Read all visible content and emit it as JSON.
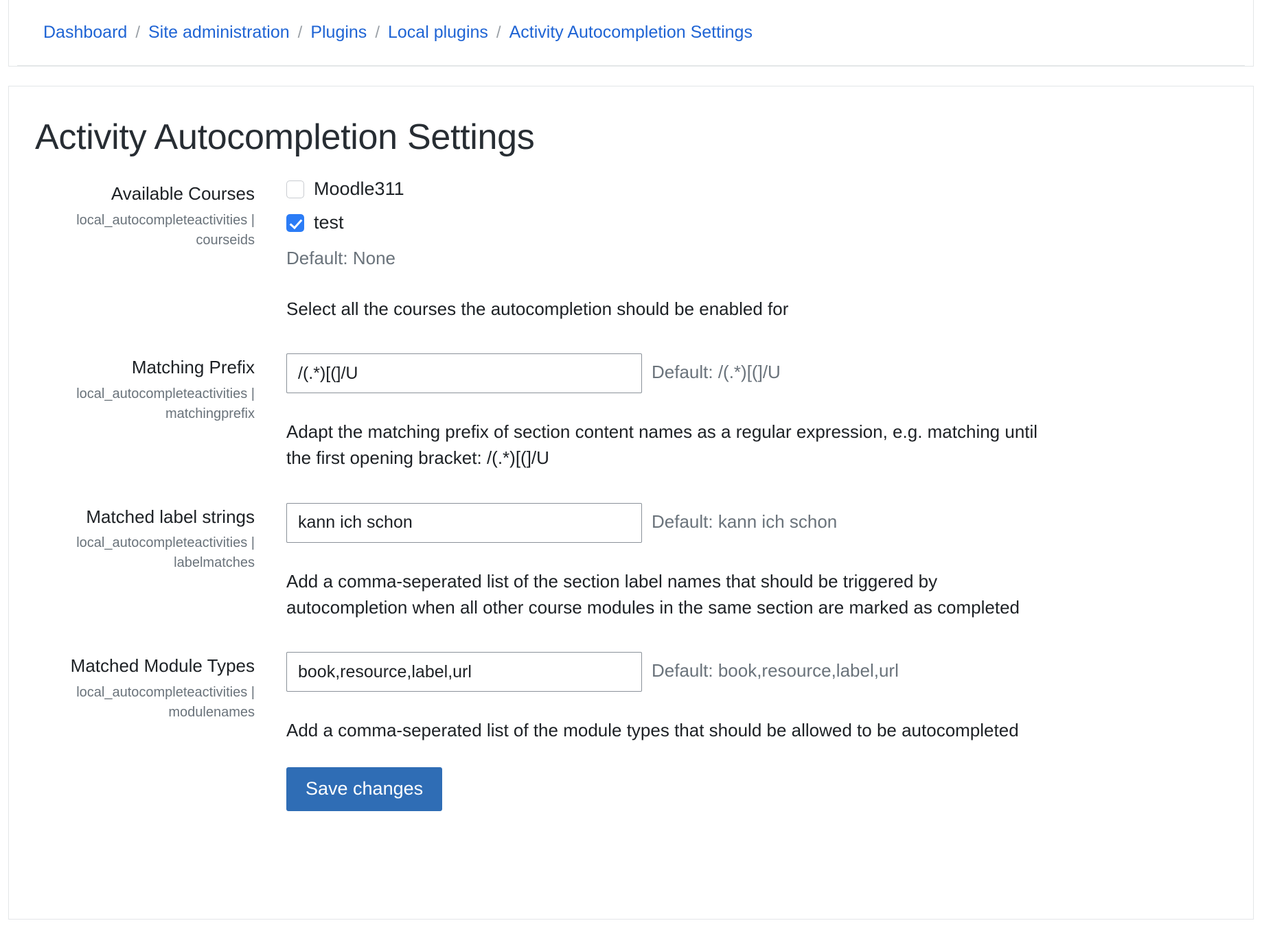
{
  "breadcrumb": {
    "separator": "/",
    "items": [
      {
        "label": "Dashboard"
      },
      {
        "label": "Site administration"
      },
      {
        "label": "Plugins"
      },
      {
        "label": "Local plugins"
      },
      {
        "label": "Activity Autocompletion Settings"
      }
    ]
  },
  "page": {
    "title": "Activity Autocompletion Settings"
  },
  "colors": {
    "link": "#1f64d4",
    "checkbox_checked": "#2b7cf6",
    "primary_button": "#2f6db5",
    "muted_text": "#6a737b"
  },
  "settings": [
    {
      "label": "Available Courses",
      "path": "local_autocompleteactivities | courseids",
      "type": "checkboxes",
      "options": [
        {
          "label": "Moodle311",
          "checked": false
        },
        {
          "label": "test",
          "checked": true
        }
      ],
      "default_text": "Default: None",
      "help": "Select all the courses the autocompletion should be enabled for"
    },
    {
      "label": "Matching Prefix",
      "path": "local_autocompleteactivities | matchingprefix",
      "type": "text",
      "value": "/(.*)[(]/U",
      "placeholder": "",
      "default_text": "Default: /(.*)[(]/U",
      "help": "Adapt the matching prefix of section content names as a regular expression, e.g. matching until the first opening bracket: /(.*)[(]/U"
    },
    {
      "label": "Matched label strings",
      "path": "local_autocompleteactivities | labelmatches",
      "type": "text",
      "value": "kann ich schon",
      "placeholder": "",
      "default_text": "Default: kann ich schon",
      "help": "Add a comma-seperated list of the section label names that should be triggered by autocompletion when all other course modules in the same section are marked as completed"
    },
    {
      "label": "Matched Module Types",
      "path": "local_autocompleteactivities | modulenames",
      "type": "text",
      "value": "book,resource,label,url",
      "placeholder": "",
      "default_text": "Default: book,resource,label,url",
      "help": "Add a comma-seperated list of the module types that should be allowed to be autocompleted"
    }
  ],
  "form": {
    "save_label": "Save changes"
  }
}
